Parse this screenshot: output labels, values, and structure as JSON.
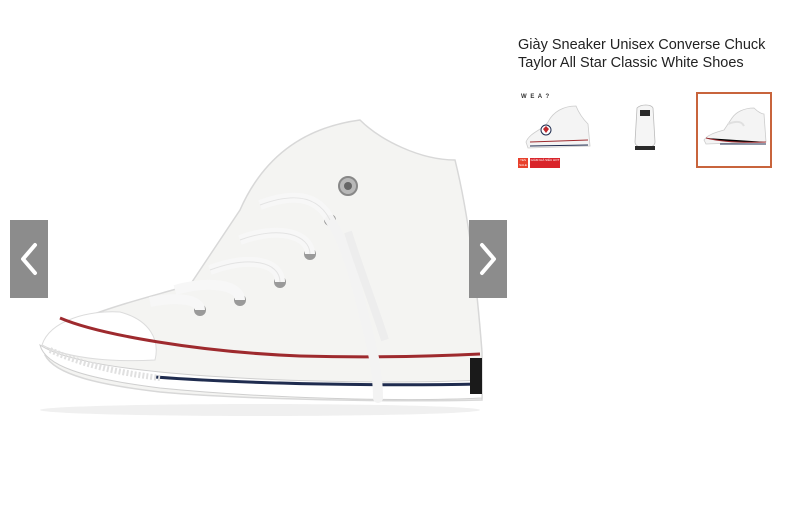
{
  "product": {
    "title": "Giày Sneaker Unisex Converse Chuck Taylor All Star Classic White Shoes"
  },
  "gallery": {
    "prev_icon": "chevron-left-icon",
    "next_icon": "chevron-right-icon",
    "thumbnails": [
      {
        "logo_text": "W E A ?",
        "badge_new": "YES SALE",
        "badge_sale": "GIẢM GIÁ SIÊU HOT"
      },
      {},
      {
        "selected": true
      }
    ]
  },
  "colors": {
    "nav_bg": "#8c8c8c",
    "selected_border": "#c8643c"
  }
}
